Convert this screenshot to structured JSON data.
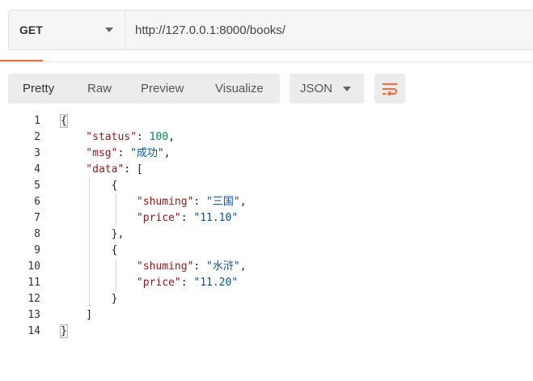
{
  "request": {
    "method": "GET",
    "url": "http://127.0.0.1:8000/books/"
  },
  "response_toolbar": {
    "views": [
      "Pretty",
      "Raw",
      "Preview",
      "Visualize"
    ],
    "active_view": "Pretty",
    "format": "JSON",
    "wrap_icon": "wrap-lines-icon",
    "accent_color": "#f26b3a"
  },
  "code": {
    "line_numbers": [
      "1",
      "2",
      "3",
      "4",
      "5",
      "6",
      "7",
      "8",
      "9",
      "10",
      "11",
      "12",
      "13",
      "14"
    ],
    "lines": [
      [
        {
          "t": "{",
          "c": "pun"
        }
      ],
      [
        {
          "t": "    \"status\"",
          "c": "key"
        },
        {
          "t": ": ",
          "c": "pun"
        },
        {
          "t": "100",
          "c": "num"
        },
        {
          "t": ",",
          "c": "pun"
        }
      ],
      [
        {
          "t": "    \"msg\"",
          "c": "key"
        },
        {
          "t": ": ",
          "c": "pun"
        },
        {
          "t": "\"成功\"",
          "c": "str"
        },
        {
          "t": ",",
          "c": "pun"
        }
      ],
      [
        {
          "t": "    \"data\"",
          "c": "key"
        },
        {
          "t": ": [",
          "c": "pun"
        }
      ],
      [
        {
          "t": "        {",
          "c": "pun"
        }
      ],
      [
        {
          "t": "            \"shuming\"",
          "c": "key"
        },
        {
          "t": ": ",
          "c": "pun"
        },
        {
          "t": "\"三国\"",
          "c": "str"
        },
        {
          "t": ",",
          "c": "pun"
        }
      ],
      [
        {
          "t": "            \"price\"",
          "c": "key"
        },
        {
          "t": ": ",
          "c": "pun"
        },
        {
          "t": "\"11.10\"",
          "c": "str"
        }
      ],
      [
        {
          "t": "        },",
          "c": "pun"
        }
      ],
      [
        {
          "t": "        {",
          "c": "pun"
        }
      ],
      [
        {
          "t": "            \"shuming\"",
          "c": "key"
        },
        {
          "t": ": ",
          "c": "pun"
        },
        {
          "t": "\"水浒\"",
          "c": "str"
        },
        {
          "t": ",",
          "c": "pun"
        }
      ],
      [
        {
          "t": "            \"price\"",
          "c": "key"
        },
        {
          "t": ": ",
          "c": "pun"
        },
        {
          "t": "\"11.20\"",
          "c": "str"
        }
      ],
      [
        {
          "t": "        }",
          "c": "pun"
        }
      ],
      [
        {
          "t": "    ]",
          "c": "pun"
        }
      ],
      [
        {
          "t": "}",
          "c": "pun"
        }
      ]
    ]
  }
}
